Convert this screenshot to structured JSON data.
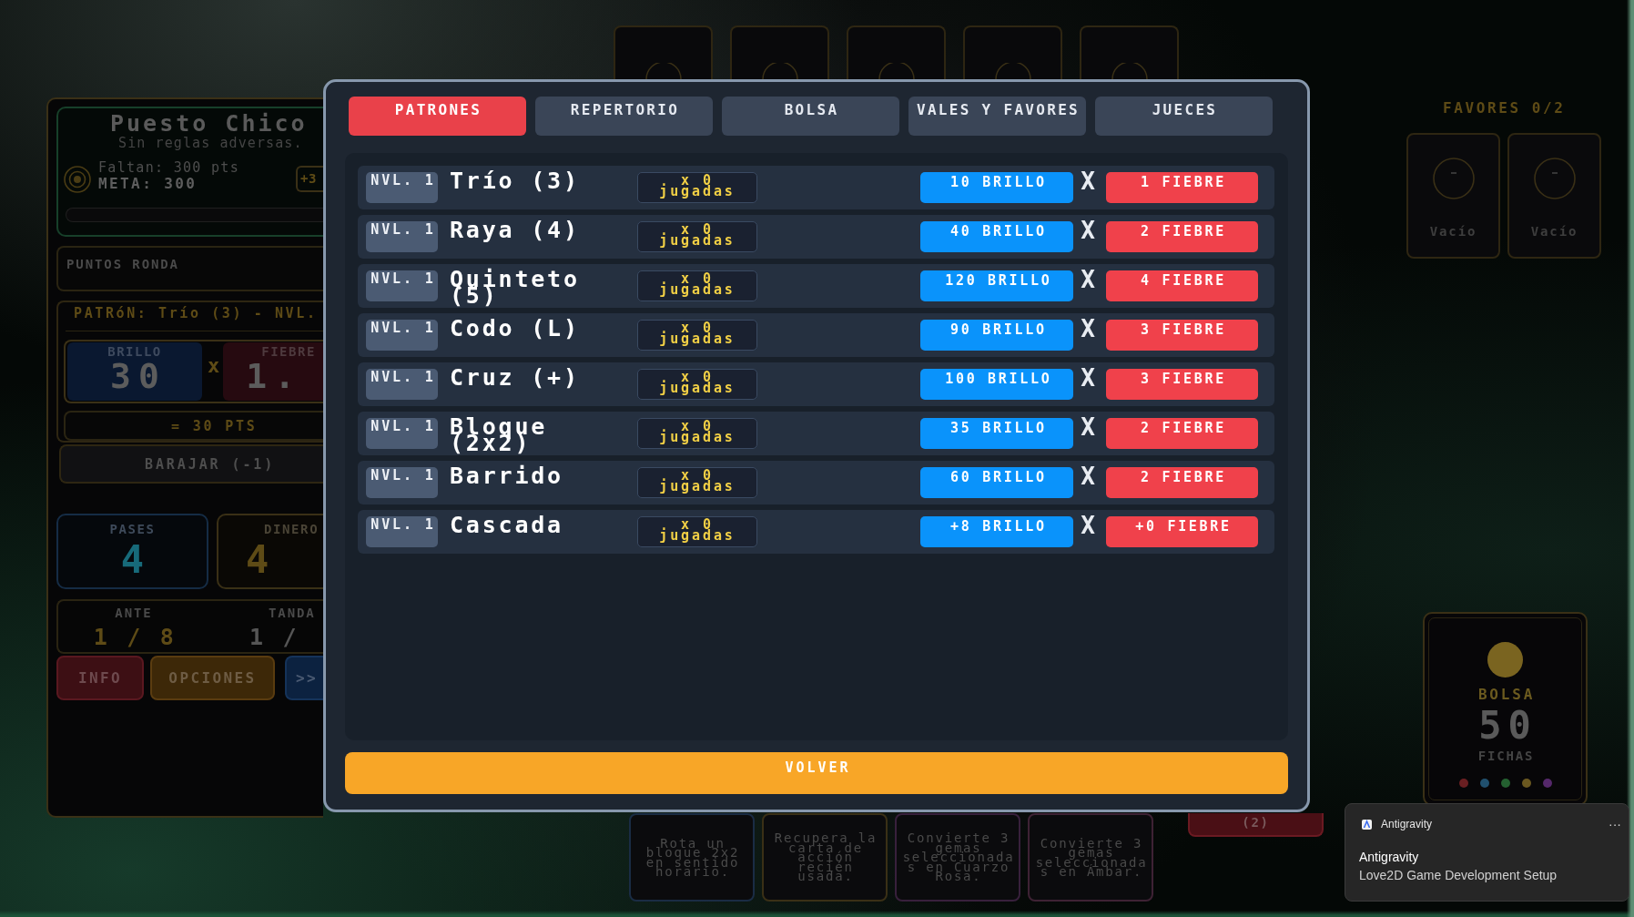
{
  "side_panel": {
    "round": {
      "title": "Puesto Chico",
      "subtitle": "Sin reglas adversas.",
      "remaining": "Faltan: 300 pts",
      "goal": "META: 300",
      "bonus": "+3",
      "progress": {
        "level": 0
      }
    },
    "round_points": {
      "label": "PUNTOS RONDA"
    },
    "pattern": {
      "title": "PATRóN: Trío (3) - NVL.",
      "brillo": {
        "label": "BRILLO",
        "value": "30"
      },
      "operator": "x",
      "fiebre": {
        "label": "FIEBRE",
        "value": "1."
      },
      "total": "= 30 PTS"
    },
    "shuffle_button": {
      "label": "BARAJAR (-1)"
    },
    "stats": [
      {
        "kind": "passes",
        "label": "PASES",
        "value": "4"
      },
      {
        "kind": "money",
        "label": "DINERO",
        "value": "4"
      }
    ],
    "counters": [
      {
        "label": "ANTE",
        "value": "1 / 8"
      },
      {
        "label": "TANDA",
        "value": "1 /"
      }
    ],
    "buttons": [
      {
        "kind": "info",
        "label": "INFO"
      },
      {
        "kind": "options",
        "label": "OPCIONES"
      },
      {
        "kind": "next",
        "label": ">>"
      }
    ]
  },
  "favors": {
    "title": "FAVORES 0/2",
    "slots": [
      {
        "label": "Vacío"
      },
      {
        "label": "Vacío"
      }
    ]
  },
  "dialog": {
    "tabs": [
      {
        "label": "PATRONES",
        "selected": true
      },
      {
        "label": "REPERTORIO",
        "selected": false
      },
      {
        "label": "BOLSA",
        "selected": false
      },
      {
        "label": "VALES Y FAVORES",
        "selected": false
      },
      {
        "label": "JUECES",
        "selected": false
      }
    ],
    "patterns": [
      {
        "tier": "NVL. 1",
        "name": "Trío (3)",
        "plays": "x 0 jugadas",
        "brillo": "10 BRILLO",
        "operator": "X",
        "fiebre": "1 FIEBRE"
      },
      {
        "tier": "NVL. 1",
        "name": "Raya (4)",
        "plays": "x 0 jugadas",
        "brillo": "40 BRILLO",
        "operator": "X",
        "fiebre": "2 FIEBRE"
      },
      {
        "tier": "NVL. 1",
        "name": "Quinteto (5)",
        "plays": "x 0 jugadas",
        "brillo": "120 BRILLO",
        "operator": "X",
        "fiebre": "4 FIEBRE"
      },
      {
        "tier": "NVL. 1",
        "name": "Codo (L)",
        "plays": "x 0 jugadas",
        "brillo": "90 BRILLO",
        "operator": "X",
        "fiebre": "3 FIEBRE"
      },
      {
        "tier": "NVL. 1",
        "name": "Cruz (+)",
        "plays": "x 0 jugadas",
        "brillo": "100 BRILLO",
        "operator": "X",
        "fiebre": "3 FIEBRE"
      },
      {
        "tier": "NVL. 1",
        "name": "Bloque (2x2)",
        "plays": "x 0 jugadas",
        "brillo": "35 BRILLO",
        "operator": "X",
        "fiebre": "2 FIEBRE"
      },
      {
        "tier": "NVL. 1",
        "name": "Barrido",
        "plays": "x 0 jugadas",
        "brillo": "60 BRILLO",
        "operator": "X",
        "fiebre": "2 FIEBRE"
      },
      {
        "tier": "NVL. 1",
        "name": "Cascada",
        "plays": "x 0 jugadas",
        "brillo": "+8 BRILLO",
        "operator": "X",
        "fiebre": "+0 FIEBRE"
      }
    ],
    "back_button": {
      "label": "VOLVER"
    }
  },
  "action_cards": [
    {
      "text": "Rota un bloque 2x2 en sentido horario.",
      "color": "#1a2c44"
    },
    {
      "text": "Recupera la carta de acción recién usada.",
      "color": "#3a3016"
    },
    {
      "text": "Convierte 3 gemas seleccionadas en Cuarzo Rosa.",
      "color": "#38203c"
    },
    {
      "text": "Convierte 3 gemas seleccionadas en Ámbar.",
      "color": "#3e2234"
    }
  ],
  "hand_button": {
    "label": "(2)"
  },
  "bag": {
    "title": "BOLSA",
    "count": "50",
    "unit": "FICHAS",
    "gems": [
      {
        "color": "#6a1f22"
      },
      {
        "color": "#21506e"
      },
      {
        "color": "#246030"
      },
      {
        "color": "#6b5820"
      },
      {
        "color": "#55286a"
      }
    ]
  },
  "notification": {
    "app": "Antigravity",
    "menu": "···",
    "title": "Antigravity",
    "body": "Love2D Game Development Setup"
  }
}
